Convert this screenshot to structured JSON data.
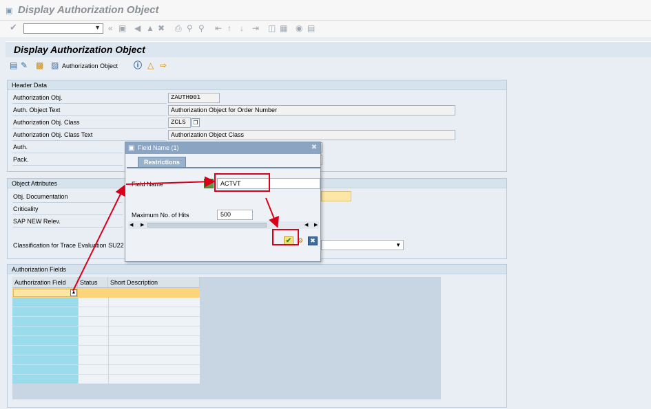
{
  "window": {
    "title": "Display Authorization Object"
  },
  "page": {
    "title": "Display Authorization Object"
  },
  "app_toolbar": {
    "auth_object_label": "Authorization Object"
  },
  "header_data": {
    "group_title": "Header Data",
    "auth_obj_label": "Authorization Obj.",
    "auth_obj_value": "ZAUTH001",
    "auth_text_label": "Auth. Object Text",
    "auth_text_value": "Authorization Object for Order Number",
    "class_label": "Authorization Obj. Class",
    "class_value": "ZCLS",
    "class_text_label": "Authorization Obj. Class Text",
    "class_text_value": "Authorization Object Class",
    "auth_label": "Auth.",
    "pack_label": "Pack."
  },
  "object_attributes": {
    "group_title": "Object Attributes",
    "obj_doc_label": "Obj. Documentation",
    "criticality_label": "Criticality",
    "sap_new_label": "SAP NEW Relev.",
    "trace_label": "Classification for Trace Evaluation SU22"
  },
  "auth_fields": {
    "group_title": "Authorization Fields",
    "columns": [
      "Authorization Field",
      "Status",
      "Short Description"
    ]
  },
  "dialog": {
    "title": "Field Name (1)",
    "tab": "Restrictions",
    "field_name_label": "Field Name",
    "field_name_value": "ACTVT",
    "max_hits_label": "Maximum No. of Hits",
    "max_hits_value": "500"
  },
  "icons": [
    "checkmark-icon",
    "save-icon",
    "back-icon",
    "exit-icon",
    "cancel-icon",
    "print-icon",
    "find-icon",
    "find-next-icon",
    "first-page-icon",
    "previous-page-icon",
    "next-page-icon",
    "last-page-icon",
    "create-session-icon",
    "shortcut-icon",
    "help-icon",
    "customize-icon",
    "display-change-icon",
    "other-object-icon",
    "where-used-icon",
    "info-icon",
    "hierarchy-icon",
    "export-icon",
    "value-help-icon",
    "multiple-selection-icon",
    "copy-icon",
    "close-icon",
    "dropdown-arrow-icon"
  ],
  "colors": {
    "highlight": "#d9001b",
    "group_header": "#d6e2ec",
    "dialog_title": "#8aa4c2",
    "row_selected": "#fcd47a",
    "grid_key_column": "#99dcec"
  }
}
